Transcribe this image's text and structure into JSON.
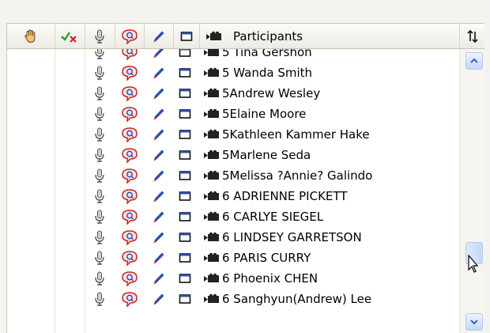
{
  "header": {
    "columns": [
      {
        "name": "raise-hand",
        "icon": "hand-icon"
      },
      {
        "name": "feedback",
        "icon": "checkmark-x-icon"
      },
      {
        "name": "audio",
        "icon": "microphone-icon"
      },
      {
        "name": "chat",
        "icon": "chat-bubble-icon"
      },
      {
        "name": "annotate",
        "icon": "pencil-icon"
      },
      {
        "name": "share",
        "icon": "screen-icon"
      },
      {
        "name": "video",
        "icon": "video-camera-icon"
      }
    ],
    "participants_label": "Participants",
    "sort_icon": "sort-arrows-icon"
  },
  "rows": [
    {
      "name": "5 Tina Gershon"
    },
    {
      "name": "5 Wanda Smith"
    },
    {
      "name": "5Andrew Wesley"
    },
    {
      "name": "5Elaine Moore"
    },
    {
      "name": "5Kathleen Kammer Hake"
    },
    {
      "name": "5Marlene Seda"
    },
    {
      "name": "5Melissa ?Annie? Galindo"
    },
    {
      "name": "6 ADRIENNE PICKETT"
    },
    {
      "name": "6 CARLYE SIEGEL"
    },
    {
      "name": "6 LINDSEY GARRETSON"
    },
    {
      "name": "6 PARIS CURRY"
    },
    {
      "name": "6 Phoenix CHEN"
    },
    {
      "name": "6 Sanghyun(Andrew) Lee"
    }
  ],
  "colors": {
    "accent_red": "#cc2222",
    "accent_blue": "#2a4fb0",
    "scroll_blue": "#c5d7fb"
  }
}
